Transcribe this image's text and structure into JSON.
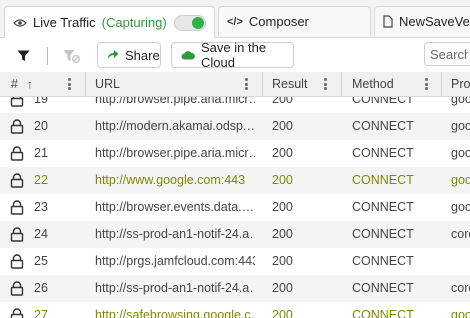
{
  "tabs": {
    "live_traffic": {
      "label": "Live Traffic",
      "status": "(Capturing)",
      "icon": "eye-icon"
    },
    "composer": {
      "label": "Composer",
      "icon": "code-icon"
    },
    "third": {
      "label": "NewSaveVers",
      "icon": "file-icon"
    }
  },
  "toolbar": {
    "share_label": "Share",
    "save_cloud_label": "Save in the Cloud",
    "search_placeholder": "Search"
  },
  "columns": {
    "num": "#",
    "url": "URL",
    "result": "Result",
    "method": "Method",
    "process": "Pro"
  },
  "colors": {
    "accent_green": "#2e9a3e",
    "highlight_text": "#7b8a00"
  },
  "rows": [
    {
      "num": "19",
      "url": "http://browser.pipe.aria.micr…",
      "result": "200",
      "method": "CONNECT",
      "process": "goo",
      "highlight": false
    },
    {
      "num": "20",
      "url": "http://modern.akamai.odsp.…",
      "result": "200",
      "method": "CONNECT",
      "process": "goo",
      "highlight": false
    },
    {
      "num": "21",
      "url": "http://browser.pipe.aria.micr…",
      "result": "200",
      "method": "CONNECT",
      "process": "goo",
      "highlight": false
    },
    {
      "num": "22",
      "url": "http://www.google.com:443",
      "result": "200",
      "method": "CONNECT",
      "process": "goo",
      "highlight": true
    },
    {
      "num": "23",
      "url": "http://browser.events.data.…",
      "result": "200",
      "method": "CONNECT",
      "process": "goo",
      "highlight": false
    },
    {
      "num": "24",
      "url": "http://ss-prod-an1-notif-24.a…",
      "result": "200",
      "method": "CONNECT",
      "process": "core",
      "highlight": false
    },
    {
      "num": "25",
      "url": "http://prgs.jamfcloud.com:443",
      "result": "200",
      "method": "CONNECT",
      "process": "",
      "highlight": false
    },
    {
      "num": "26",
      "url": "http://ss-prod-an1-notif-24.a…",
      "result": "200",
      "method": "CONNECT",
      "process": "core",
      "highlight": false
    },
    {
      "num": "27",
      "url": "http://safebrowsing.google.c…",
      "result": "200",
      "method": "CONNECT",
      "process": "goo",
      "highlight": true
    }
  ]
}
